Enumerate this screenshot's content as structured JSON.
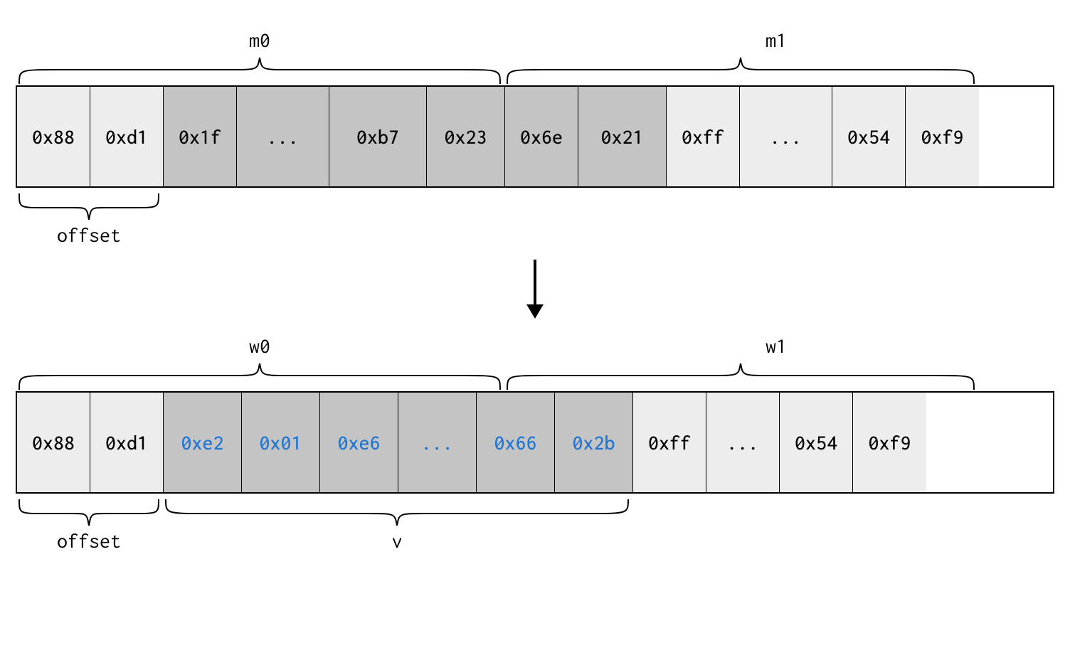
{
  "labels": {
    "m0": "m0",
    "m1": "m1",
    "w0": "w0",
    "w1": "w1",
    "offset_top": "offset",
    "offset_bottom": "offset",
    "v": "v"
  },
  "top_row": {
    "cells": [
      {
        "val": "0x88",
        "bg": "light"
      },
      {
        "val": "0xd1",
        "bg": "light"
      },
      {
        "val": "0x1f",
        "bg": "dark"
      },
      {
        "val": "...",
        "bg": "dark"
      },
      {
        "val": "0xb7",
        "bg": "dark"
      },
      {
        "val": "0x23",
        "bg": "dark"
      },
      {
        "val": "0x6e",
        "bg": "dark"
      },
      {
        "val": "0x21",
        "bg": "dark"
      },
      {
        "val": "0xff",
        "bg": "light"
      },
      {
        "val": "...",
        "bg": "light"
      },
      {
        "val": "0x54",
        "bg": "light"
      },
      {
        "val": "0xf9",
        "bg": "light"
      }
    ]
  },
  "bottom_row": {
    "cells": [
      {
        "val": "0x88",
        "bg": "light"
      },
      {
        "val": "0xd1",
        "bg": "light"
      },
      {
        "val": "0xe2",
        "bg": "dark",
        "color": "blue"
      },
      {
        "val": "0x01",
        "bg": "dark",
        "color": "blue"
      },
      {
        "val": "0xe6",
        "bg": "dark",
        "color": "blue"
      },
      {
        "val": "...",
        "bg": "dark",
        "color": "blue"
      },
      {
        "val": "0x66",
        "bg": "dark",
        "color": "blue"
      },
      {
        "val": "0x2b",
        "bg": "dark",
        "color": "blue"
      },
      {
        "val": "0xff",
        "bg": "light"
      },
      {
        "val": "...",
        "bg": "light"
      },
      {
        "val": "0x54",
        "bg": "light"
      },
      {
        "val": "0xf9",
        "bg": "light"
      }
    ]
  },
  "layout": {
    "top_widths": [
      103,
      103,
      103,
      130,
      137,
      110,
      103,
      124,
      103,
      130,
      103,
      103
    ],
    "bottom_widths": [
      103,
      103,
      110,
      110,
      110,
      110,
      110,
      110,
      103,
      103,
      103,
      103
    ]
  }
}
